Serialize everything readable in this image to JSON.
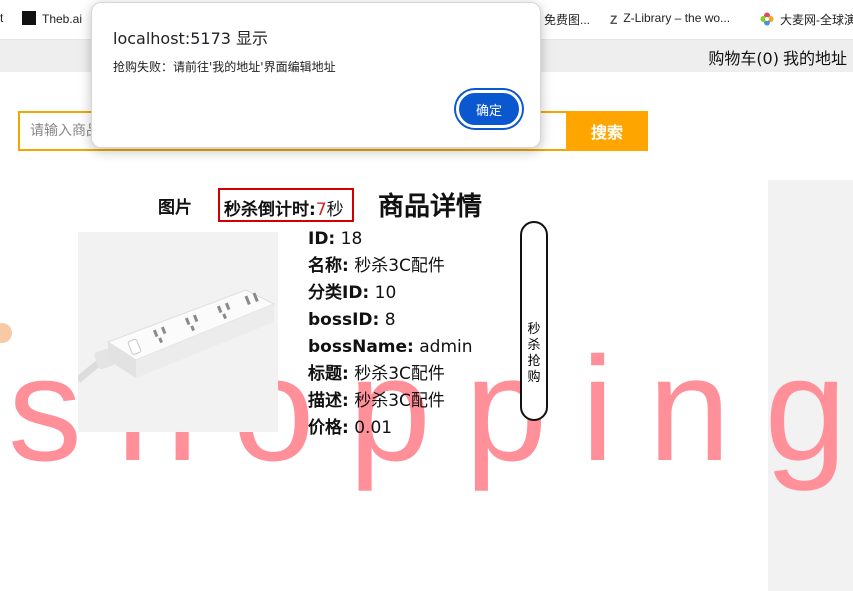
{
  "browser": {
    "bookmarks": [
      {
        "label": "t",
        "icon": "bookmark-icon"
      },
      {
        "label": "Theb.ai",
        "icon": "theb-icon"
      },
      {
        "label": "免费图...",
        "icon": "bookmark-icon"
      },
      {
        "label": "Z-Library – the wo...",
        "icon": "zlibrary-icon"
      },
      {
        "label": "大麦网-全球演",
        "icon": "damai-icon"
      }
    ]
  },
  "header": {
    "cart_label": "购物车(0)",
    "address_label": "我的地址"
  },
  "search": {
    "placeholder": "请输入商品名称",
    "button_label": "搜索"
  },
  "banner_word": "shopping",
  "product": {
    "picture_label": "图片",
    "countdown_label": "秒杀倒计时:",
    "countdown_value": "7",
    "countdown_unit": "秒",
    "detail_title": "商品详情",
    "fields": [
      {
        "key": "ID:",
        "value": "18"
      },
      {
        "key": "名称:",
        "value": "秒杀3C配件"
      },
      {
        "key": "分类ID:",
        "value": "10"
      },
      {
        "key": "bossID:",
        "value": "8"
      },
      {
        "key": "bossName:",
        "value": "admin"
      },
      {
        "key": "标题:",
        "value": "秒杀3C配件"
      },
      {
        "key": "描述:",
        "value": "秒杀3C配件"
      },
      {
        "key": "价格:",
        "value": "0.01"
      }
    ],
    "buy_button_label": "秒杀抢购"
  },
  "dialog": {
    "title": "localhost:5173 显示",
    "message": "抢购失败：请前往'我的地址'界面编辑地址",
    "ok_label": "确定"
  },
  "colors": {
    "accent": "#ffa500",
    "dialog_button": "#0b57d0",
    "countdown_border": "#d40000",
    "banner_text": "#ff8f98"
  }
}
